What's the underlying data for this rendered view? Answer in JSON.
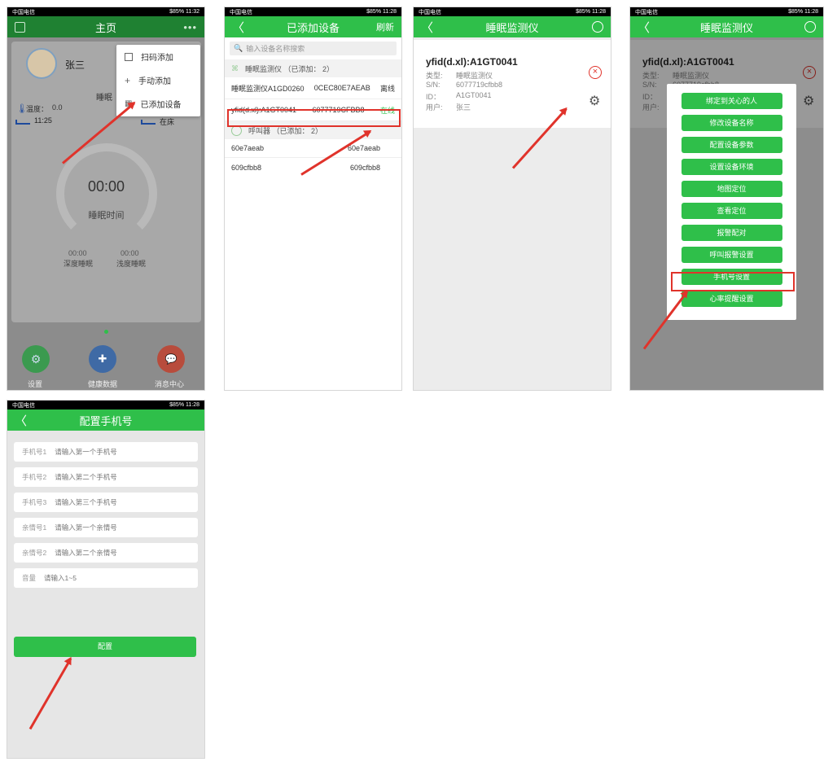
{
  "status": {
    "carrier": "中国电信",
    "p1_time": "$85% 11:32",
    "time": "$85% 11:28"
  },
  "p1": {
    "title": "主页",
    "user_name": "张三",
    "sleep_partial": "睡眠",
    "temp_label": "温度：",
    "temp_value": "0.0",
    "time_value": "11:25",
    "bed_status": "在床",
    "timer": "00:00",
    "timer_label": "睡眠时间",
    "deep_time": "00:00",
    "deep_label": "深度睡眠",
    "light_time": "00:00",
    "light_label": "浅度睡眠",
    "menu": [
      "扫码添加",
      "手动添加",
      "已添加设备"
    ],
    "nav": [
      "设置",
      "健康数据",
      "消息中心"
    ]
  },
  "p2": {
    "title": "已添加设备",
    "refresh": "刷新",
    "search_placeholder": "输入设备名称搜索",
    "group1": "睡眠监测仪 （已添加： 2）",
    "row1": {
      "name": "睡眠监测仪A1GD0260",
      "sn": "0CEC80E7AEAB",
      "status": "离线"
    },
    "row2": {
      "name": "yfid(d.xl):A1GT0041",
      "sn": "6077719CFBB8",
      "status": "在线"
    },
    "group2": "呼叫器 （已添加： 2）",
    "row3": {
      "name": "60e7aeab",
      "sn": "60e7aeab"
    },
    "row4": {
      "name": "609cfbb8",
      "sn": "609cfbb8"
    }
  },
  "p3": {
    "title": "睡眠监测仪",
    "device_name": "yfid(d.xl):A1GT0041",
    "type_label": "类型:",
    "type_value": "睡眠监测仪",
    "sn_label": "S/N:",
    "sn_value": "6077719cfbb8",
    "id_label": "ID：",
    "id_value": "A1GT0041",
    "user_label": "用户:",
    "user_value": "张三"
  },
  "p4": {
    "title": "睡眠监测仪",
    "device_name": "yfid(d.xl):A1GT0041",
    "type_label": "类型:",
    "type_value": "睡眠监测仪",
    "sn_label": "S/N:",
    "sn_value": "6077719cfbb8",
    "id_label": "ID：",
    "user_label": "用户:",
    "menu": [
      "绑定到关心的人",
      "修改设备名称",
      "配置设备参数",
      "设置设备环境",
      "地图定位",
      "查看定位",
      "报警配对",
      "呼叫报警设置",
      "手机号设置",
      "心率提醒设置"
    ]
  },
  "p5": {
    "title": "配置手机号",
    "fields": [
      {
        "label": "手机号1",
        "placeholder": "请输入第一个手机号"
      },
      {
        "label": "手机号2",
        "placeholder": "请输入第二个手机号"
      },
      {
        "label": "手机号3",
        "placeholder": "请输入第三个手机号"
      },
      {
        "label": "亲情号1",
        "placeholder": "请输入第一个亲情号"
      },
      {
        "label": "亲情号2",
        "placeholder": "请输入第二个亲情号"
      },
      {
        "label": "音量",
        "placeholder": "请输入1~5"
      }
    ],
    "submit": "配置"
  }
}
